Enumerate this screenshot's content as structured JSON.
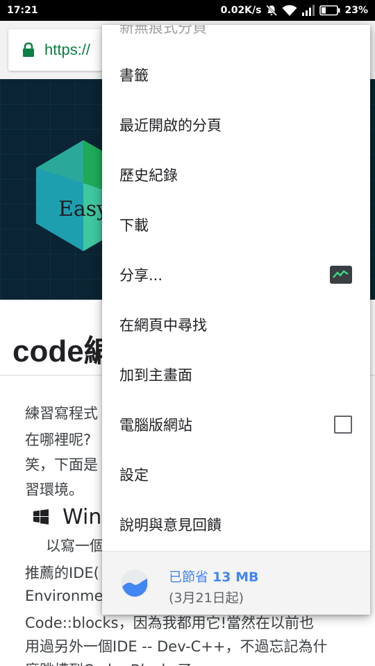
{
  "status_bar": {
    "time": "17:21",
    "network_speed": "0.02K/s",
    "battery": "23%"
  },
  "toolbar": {
    "url_text": "https://"
  },
  "hero": {
    "logo_text": "Easy"
  },
  "article": {
    "title": "code編",
    "lines": [
      "練習寫程式",
      "在哪裡呢?",
      "笑，下面是",
      "習環境。"
    ],
    "heading": "Wind",
    "para_lines": [
      "以寫一個",
      "推薦的IDE(",
      "Environme",
      "Code::blocks，因為我都用它!當然在以前也",
      "用過另外一個IDE -- Dev-C++，不過忘記為什",
      "麼跳槽到Code::Blocks了"
    ]
  },
  "menu": {
    "cutoff_item": "新無痕式分頁",
    "items": [
      {
        "label": "書籤"
      },
      {
        "label": "最近開啟的分頁"
      },
      {
        "label": "歷史紀錄"
      },
      {
        "label": "下載"
      },
      {
        "label": "分享..."
      },
      {
        "label": "在網頁中尋找"
      },
      {
        "label": "加到主畫面"
      },
      {
        "label": "電腦版網站",
        "checked": false
      },
      {
        "label": "設定"
      },
      {
        "label": "說明與意見回饋"
      }
    ],
    "data_saver": {
      "prefix": "已節省 ",
      "amount": "13 MB",
      "since": "(3月21日起)"
    }
  },
  "colors": {
    "secure_green": "#0b8043",
    "saver_blue": "#4285f4",
    "hero_bg": "#0a2433"
  },
  "icons": [
    "lock-icon",
    "mute-icon",
    "wifi-icon",
    "signal-icon",
    "battery-icon",
    "share-app-icon",
    "windows-icon",
    "data-saver-icon"
  ]
}
